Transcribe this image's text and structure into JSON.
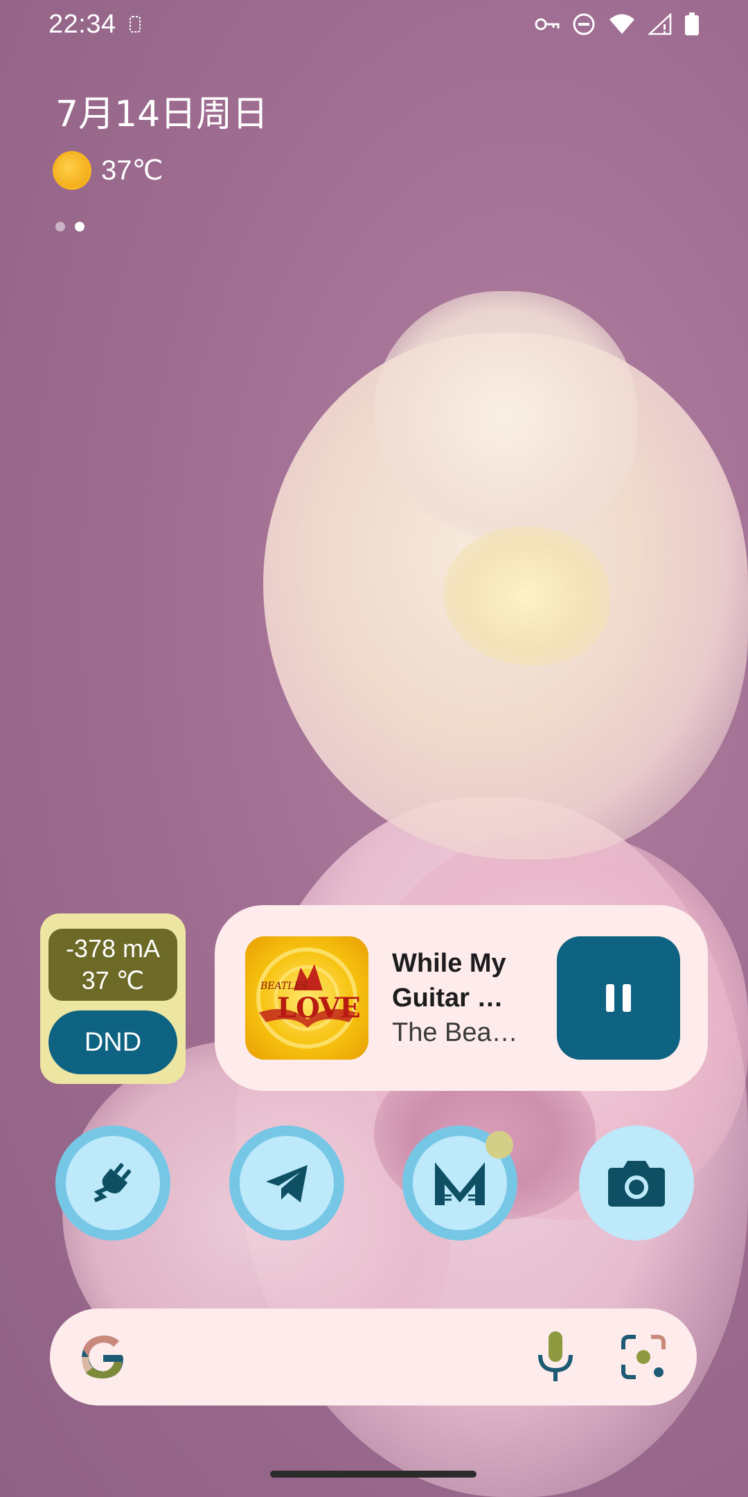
{
  "status_bar": {
    "time": "22:34",
    "icons": [
      "sim-icon",
      "vpn-key-icon",
      "dnd-icon",
      "wifi-icon",
      "signal-icon",
      "battery-icon"
    ]
  },
  "home": {
    "date": "7月14日周日",
    "weather": {
      "icon": "sun-icon",
      "temperature": "37℃"
    },
    "page_indicator": {
      "pages": 2,
      "active_index": 1
    }
  },
  "battery_widget": {
    "current": "-378 mA",
    "temperature": "37 ℃",
    "dnd_label": "DND",
    "colors": {
      "background": "#ede6a2",
      "stats_bg": "#6c6a26",
      "button": "#0e6282"
    }
  },
  "media_widget": {
    "album_art": {
      "small_text": "BEATLES",
      "big_text": "LOVE"
    },
    "title": "While My Guitar …",
    "artist": "The Bea…",
    "control": "pause-icon"
  },
  "dock": [
    {
      "name": "plug-app-icon"
    },
    {
      "name": "telegram-icon"
    },
    {
      "name": "mail-cat-icon",
      "has_notification": true
    },
    {
      "name": "camera-icon"
    }
  ],
  "search_bar": {
    "logo": "google-g-icon",
    "mic": "mic-icon",
    "lens": "lens-icon"
  },
  "colors": {
    "accent": "#0e6282",
    "surface": "#fdeceb",
    "icon_ring": "#76c7e6",
    "icon_fill": "#bde9fb"
  }
}
